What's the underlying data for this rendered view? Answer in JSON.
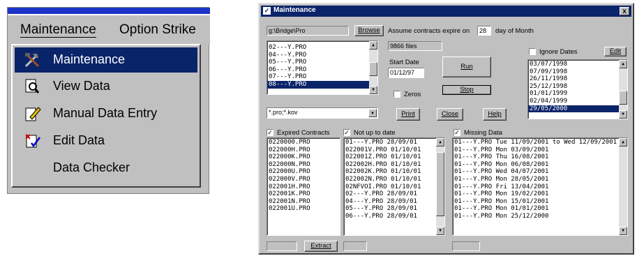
{
  "menu": {
    "menubar": [
      "Maintenance",
      "Option Strike"
    ],
    "items": [
      {
        "label": "Maintenance",
        "icon": "tools-icon",
        "selected": true
      },
      {
        "label": "View Data",
        "icon": "magnifier-icon"
      },
      {
        "label": "Manual Data Entry",
        "icon": "pencil-notepad-icon"
      },
      {
        "label": "Edit Data",
        "icon": "edit-data-icon"
      },
      {
        "label": "Data Checker",
        "icon": ""
      }
    ]
  },
  "window": {
    "title": "Maintenance",
    "close_label": "x",
    "path": "g:\\Bridge\\Pro",
    "browse_label": "Browse",
    "expiry_prefix": "Assume contracts expire on",
    "expiry_day": "28",
    "expiry_suffix": "day of Month",
    "file_count": "9866 files",
    "start_date_label": "Start Date",
    "start_date": "01/12/97",
    "run_label": "Run",
    "stop_label": "Stop",
    "zeros_label": "Zeros",
    "filter": "*.pro;*.kov",
    "print_label": "Print",
    "close_label_btn": "Close",
    "help_label": "Help",
    "ignore_dates_label": "Ignore Dates",
    "edit_label": "Edit",
    "extract_label": "Extract",
    "files": [
      "02---Y.PRO",
      "04---Y.PRO",
      "05---Y.PRO",
      "06---Y.PRO",
      "07---Y.PRO",
      "08---Y.PRO"
    ],
    "dates": [
      "03/07/1998",
      "07/09/1998",
      "26/11/1998",
      "25/12/1998",
      "01/01/1999",
      "02/04/1999",
      "29/05/2000"
    ],
    "expired": {
      "label": "Expired Contracts",
      "items": [
        "0220000.PRO",
        "022000H.PRO",
        "022000K.PRO",
        "022000N.PRO",
        "022000U.PRO",
        "022000V.PRO",
        "022001H.PRO",
        "022001K.PRO",
        "022001N.PRO",
        "022001U.PRO"
      ]
    },
    "notuptodate": {
      "label": "Not up to date",
      "items": [
        "01---Y.PRO   28/09/01",
        "022001V.PRO   01/10/01",
        "022001Z.PRO   01/10/01",
        "022002H.PRO   01/10/01",
        "022002K.PRO   01/10/01",
        "022002N.PRO   01/10/01",
        "02NFVOI.PRO   01/10/01",
        "02---Y.PRO   28/09/01",
        "04---Y.PRO   28/09/01",
        "05---Y.PRO   28/09/01",
        "06---Y.PRO   28/09/01"
      ]
    },
    "missing": {
      "label": "Missing Data",
      "items": [
        "01---Y.PRO  Tue 11/09/2001 to Wed 12/09/2001",
        "01---Y.PRO  Mon 03/09/2001",
        "01---Y.PRO  Thu 16/08/2001",
        "01---Y.PRO  Mon 06/08/2001",
        "01---Y.PRO  Wed 04/07/2001",
        "01---Y.PRO  Mon 28/05/2001",
        "01---Y.PRO  Fri 13/04/2001",
        "01---Y.PRO  Mon 19/02/2001",
        "01---Y.PRO  Mon 15/01/2001",
        "01---Y.PRO  Mon 01/01/2001",
        "01---Y.PRO  Mon 25/12/2000"
      ]
    }
  }
}
